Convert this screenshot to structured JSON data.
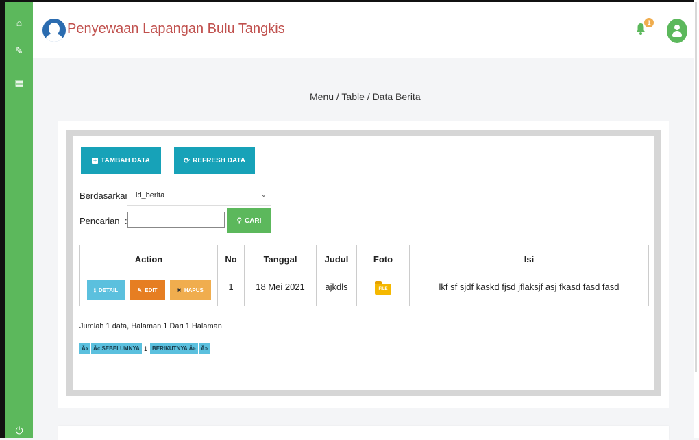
{
  "app": {
    "title": "Penyewaan Lapangan Bulu Tangkis"
  },
  "sidebar": {
    "items": [
      {
        "icon": "home-icon",
        "glyph": "⌂"
      },
      {
        "icon": "edit-icon",
        "glyph": "✎"
      },
      {
        "icon": "calendar-icon",
        "glyph": "▦"
      },
      {
        "icon": "power-icon",
        "glyph": "⏻"
      }
    ]
  },
  "header": {
    "notification_count": "1"
  },
  "breadcrumb": "Menu / Table / Data Berita",
  "toolbar": {
    "add_label": "TAMBAH DATA",
    "refresh_label": "REFRESH DATA",
    "filter_label": "Berdasarkan:",
    "filter_value": "id_berita",
    "search_label": "Pencarian",
    "search_colon": ":",
    "search_value": "",
    "search_button": "CARI"
  },
  "table": {
    "headers": [
      "Action",
      "No",
      "Tanggal",
      "Judul",
      "Foto",
      "Isi"
    ],
    "rows": [
      {
        "actions": {
          "detail": "DETAIL",
          "edit": "EDIT",
          "delete": "HAPUS"
        },
        "no": "1",
        "tanggal": "18 Mei 2021",
        "judul": "ajkdls",
        "foto": "FILE",
        "isi": "lkf sf sjdf kaskd fjsd jflaksjf asj fkasd fasd fasd"
      }
    ]
  },
  "summary": "Jumlah 1 data, Halaman 1 Dari 1 Halaman",
  "pagination": {
    "first": "Â«",
    "prev": "Â« SEBELUMNYA",
    "current": "1",
    "next": "BERIKUTNYA Â»",
    "last": "Â»"
  },
  "colors": {
    "sidebar": "#5cb85c",
    "title": "#c0504d",
    "primary": "#17a2b8",
    "success": "#5cb85c",
    "detail": "#5bc0de",
    "edit": "#e67e22",
    "delete": "#f0ad4e"
  }
}
